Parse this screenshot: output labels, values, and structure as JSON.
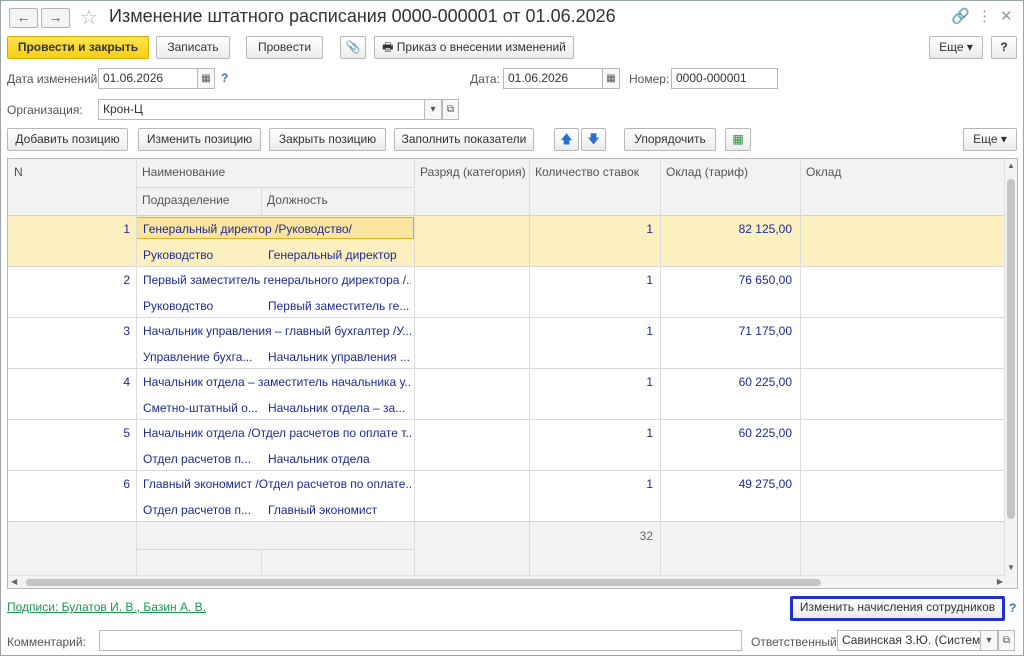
{
  "window": {
    "title": "Изменение штатного расписания 0000-000001 от 01.06.2026"
  },
  "toolbar": {
    "post_close": "Провести и закрыть",
    "save": "Записать",
    "post": "Провести",
    "order": "Приказ о внесении изменений",
    "more": "Еще"
  },
  "form": {
    "change_date_label": "Дата изменений:",
    "change_date_value": "01.06.2026",
    "date_label": "Дата:",
    "date_value": "01.06.2026",
    "number_label": "Номер:",
    "number_value": "0000-000001",
    "org_label": "Организация:",
    "org_value": "Крон-Ц"
  },
  "table_toolbar": {
    "add": "Добавить позицию",
    "edit": "Изменить позицию",
    "close": "Закрыть позицию",
    "fill": "Заполнить показатели",
    "sort": "Упорядочить",
    "more": "Еще"
  },
  "table": {
    "headers": {
      "n": "N",
      "name": "Наименование",
      "division": "Подразделение",
      "position": "Должность",
      "rank": "Разряд (категория)",
      "rates": "Количество ставок",
      "salary_tariff": "Оклад (тариф)",
      "salary": "Оклад"
    },
    "rows": [
      {
        "n": "1",
        "name": "Генеральный директор /Руководство/",
        "division": "Руководство",
        "position": "Генеральный директор",
        "rates": "1",
        "salary": "82 125,00"
      },
      {
        "n": "2",
        "name": "Первый заместитель генерального директора /...",
        "division": "Руководство",
        "position": "Первый заместитель ге...",
        "rates": "1",
        "salary": "76 650,00"
      },
      {
        "n": "3",
        "name": "Начальник управления – главный бухгалтер /У...",
        "division": "Управление бухга...",
        "position": "Начальник управления ...",
        "rates": "1",
        "salary": "71 175,00"
      },
      {
        "n": "4",
        "name": "Начальник отдела – заместитель начальника у...",
        "division": "Сметно-штатный о...",
        "position": "Начальник отдела – за...",
        "rates": "1",
        "salary": "60 225,00"
      },
      {
        "n": "5",
        "name": "Начальник отдела /Отдел расчетов по оплате т...",
        "division": "Отдел расчетов п...",
        "position": "Начальник отдела",
        "rates": "1",
        "salary": "60 225,00"
      },
      {
        "n": "6",
        "name": "Главный экономист /Отдел расчетов по оплате...",
        "division": "Отдел расчетов п...",
        "position": "Главный экономист",
        "rates": "1",
        "salary": "49 275,00"
      }
    ],
    "total_rates": "32"
  },
  "footer": {
    "signatures": "Подписи: Булатов И. В., Базин А. В.",
    "change_accruals": "Изменить начисления сотрудников",
    "comment_label": "Комментарий:",
    "comment_value": "",
    "responsible_label": "Ответственный:",
    "responsible_value": "Савинская З.Ю. (Системн"
  }
}
